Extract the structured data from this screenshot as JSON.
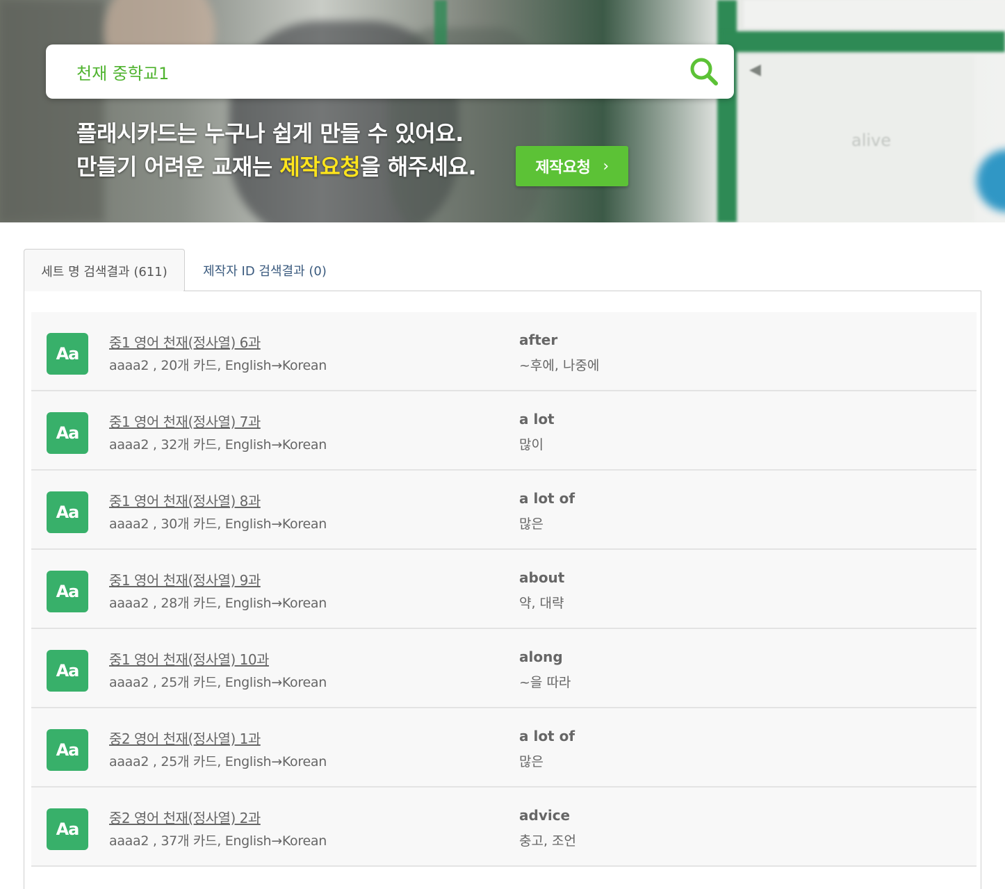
{
  "search": {
    "value": "천재 중학교1",
    "placeholder": ""
  },
  "hero": {
    "line1": "플래시카드는 누구나 쉽게 만들 수 있어요.",
    "line2_before": "만들기 어려운 교재는 ",
    "line2_highlight": "제작요청",
    "line2_after": "을 해주세요.",
    "request_button": "제작요청",
    "request_chevron": "›",
    "bg_text": "alive"
  },
  "tabs": [
    {
      "label": "세트 명 검색결과 (611)",
      "active": true
    },
    {
      "label": "제작자 ID 검색결과 (0)",
      "active": false
    }
  ],
  "badge_label": "Aa",
  "results": [
    {
      "title": "중1 영어 천재(정사열) 6과",
      "meta": "aaaa2 , 20개 카드, English→Korean",
      "word": "after",
      "definition": "~후에, 나중에"
    },
    {
      "title": "중1 영어 천재(정사열) 7과",
      "meta": "aaaa2 , 32개 카드, English→Korean",
      "word": "a lot",
      "definition": "많이"
    },
    {
      "title": "중1 영어 천재(정사열) 8과",
      "meta": "aaaa2 , 30개 카드, English→Korean",
      "word": "a lot of",
      "definition": "많은"
    },
    {
      "title": "중1 영어 천재(정사열) 9과",
      "meta": "aaaa2 , 28개 카드, English→Korean",
      "word": "about",
      "definition": "약, 대략"
    },
    {
      "title": "중1 영어 천재(정사열) 10과",
      "meta": "aaaa2 , 25개 카드, English→Korean",
      "word": "along",
      "definition": "~을 따라"
    },
    {
      "title": "중2 영어 천재(정사열) 1과",
      "meta": "aaaa2 , 25개 카드, English→Korean",
      "word": "a lot of",
      "definition": "많은"
    },
    {
      "title": "중2 영어 천재(정사열) 2과",
      "meta": "aaaa2 , 37개 카드, English→Korean",
      "word": "advice",
      "definition": "충고, 조언"
    }
  ],
  "colors": {
    "brand_green": "#5cc236",
    "badge_green": "#38b06a",
    "highlight_yellow": "#ffe51c",
    "tab_link": "#3a5a7e"
  },
  "icons": {
    "search": "search-icon",
    "chevron": "chevron-right-icon"
  }
}
